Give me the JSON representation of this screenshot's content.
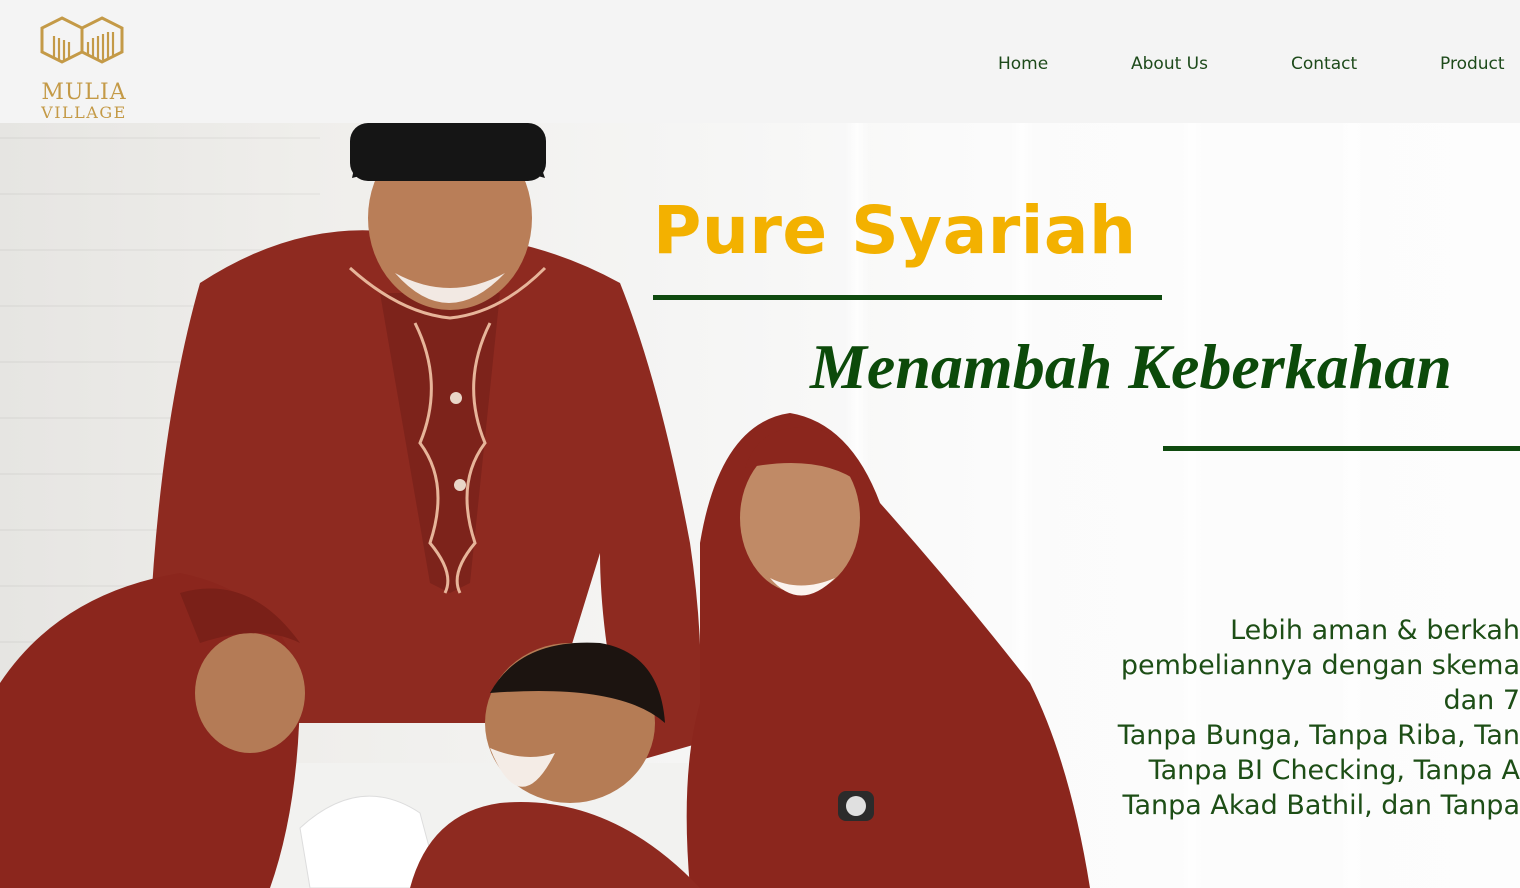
{
  "header": {
    "logo": {
      "line1": "MULIA",
      "line2": "VILLAGE"
    },
    "nav": [
      "Home",
      "About Us",
      "Contact",
      "Product"
    ]
  },
  "hero": {
    "headline": "Pure Syariah",
    "subheadline": "Menambah Keberkahan",
    "description_lines": [
      "Lebih aman & berkah",
      "pembeliannya dengan skema",
      "dan 7",
      "Tanpa Bunga, Tanpa Riba, Tan",
      "Tanpa BI Checking, Tanpa A",
      "Tanpa Akad Bathil, dan Tanpa"
    ],
    "photo": "family-photo"
  },
  "colors": {
    "brand_gold": "#c49a47",
    "headline_yellow": "#f3b100",
    "brand_green": "#0c4a0a",
    "nav_text": "#1d4a1a",
    "outfit_red": "#8e2a20"
  }
}
